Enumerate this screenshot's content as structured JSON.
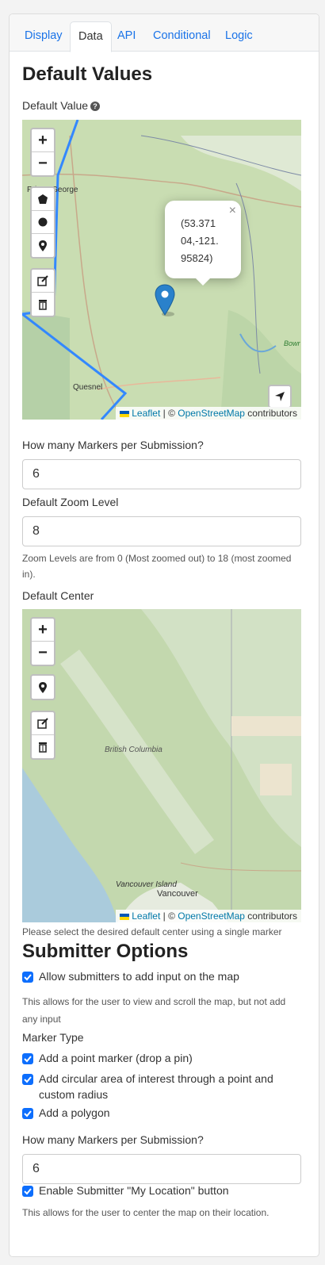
{
  "tabs": [
    {
      "label": "Display",
      "active": false
    },
    {
      "label": "Data",
      "active": true
    },
    {
      "label": "API",
      "active": false
    },
    {
      "label": "Conditional",
      "active": false
    },
    {
      "label": "Logic",
      "active": false
    }
  ],
  "default_values": {
    "heading": "Default Values",
    "default_value_label": "Default Value",
    "map1": {
      "popup_text": "(53.371 04,-121. 95824)",
      "places": {
        "prince_george": "Prince George",
        "quesnel": "Quesnel",
        "bowron": "Bowr Lake Pro Par"
      },
      "attribution": {
        "leaflet": "Leaflet",
        "sep": " | © ",
        "osm": "OpenStreetMap",
        "contributors": " contributors"
      }
    },
    "markers_label": "How many Markers per Submission?",
    "markers_value": "6",
    "zoom_label": "Default Zoom Level",
    "zoom_value": "8",
    "zoom_help": "Zoom Levels are from 0 (Most zoomed out) to 18 (most zoomed in).",
    "center_label": "Default Center",
    "map2": {
      "places": {
        "bc": "British Columbia",
        "vancouver_island": "Vancouver Island",
        "vancouver": "Vancouver"
      },
      "attribution": {
        "leaflet": "Leaflet",
        "sep": " | © ",
        "osm": "OpenStreetMap",
        "contributors": " contributors"
      }
    },
    "center_help": "Please select the desired default center using a single marker"
  },
  "submitter": {
    "heading": "Submitter Options",
    "allow_input_label": "Allow submitters to add input on the map",
    "allow_input_checked": true,
    "allow_input_help": "This allows for the user to view and scroll the map, but not add any input",
    "marker_type_label": "Marker Type",
    "marker_types": [
      {
        "label": "Add a point marker (drop a pin)",
        "checked": true
      },
      {
        "label": "Add circular area of interest through a point and custom radius",
        "checked": true
      },
      {
        "label": "Add a polygon",
        "checked": true
      }
    ],
    "markers_label": "How many Markers per Submission?",
    "markers_value": "6",
    "my_location_label": "Enable Submitter \"My Location\" button",
    "my_location_checked": true,
    "my_location_help": "This allows for the user to center the map on their location."
  },
  "colors": {
    "accent": "#1a73e8",
    "checkbox": "#0d6efd",
    "marker": "#2a81cb",
    "boundary": "#3388ff"
  },
  "icons": [
    "question-circle-icon",
    "zoom-in-icon",
    "zoom-out-icon",
    "polygon-icon",
    "circle-icon",
    "marker-icon",
    "edit-icon",
    "trash-icon",
    "close-icon",
    "locate-arrow-icon",
    "check-icon",
    "map-pin-icon"
  ]
}
